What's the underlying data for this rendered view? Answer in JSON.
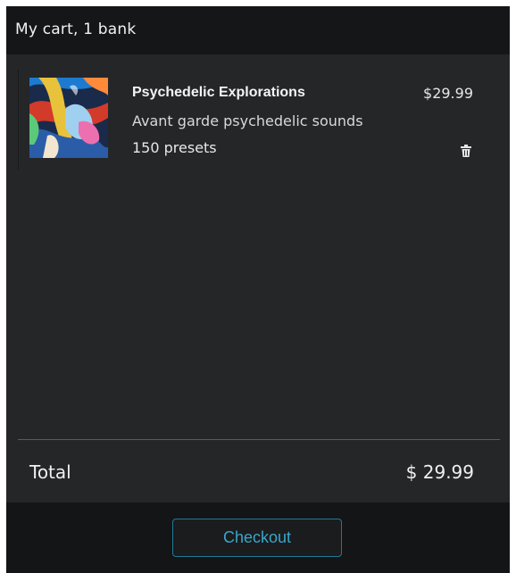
{
  "header": {
    "title": "My cart, 1 bank"
  },
  "cart": {
    "items": [
      {
        "title": "Psychedelic Explorations",
        "description": "Avant garde psychedelic sounds",
        "presets": "150 presets",
        "price": "$29.99",
        "thumbnail_icon": "album-art-psychedelic",
        "remove_icon": "trash-icon"
      }
    ]
  },
  "summary": {
    "total_label": "Total",
    "total_value": "$ 29.99"
  },
  "footer": {
    "checkout_label": "Checkout"
  },
  "colors": {
    "panel_bg": "#252628",
    "header_bg": "#151617",
    "footer_bg": "#141516",
    "accent": "#3aa6c9"
  }
}
